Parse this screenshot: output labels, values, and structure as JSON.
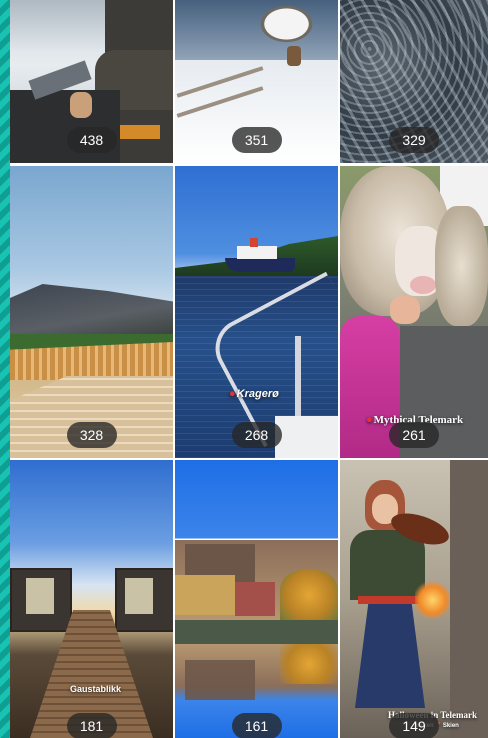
{
  "videos": [
    {
      "views": "438"
    },
    {
      "views": "351"
    },
    {
      "views": "329"
    },
    {
      "views": "328"
    },
    {
      "views": "268",
      "caption": "Kragerø"
    },
    {
      "views": "261",
      "caption": "Mythical Telemark"
    },
    {
      "views": "181",
      "caption": "Gaustablikk"
    },
    {
      "views": "161"
    },
    {
      "views": "149",
      "caption": "Halloween in Telemark",
      "caption2": "parken 📍Skien"
    }
  ],
  "colors": {
    "accent_stripe": "#19c3b3",
    "badge_bg": "#262626"
  }
}
